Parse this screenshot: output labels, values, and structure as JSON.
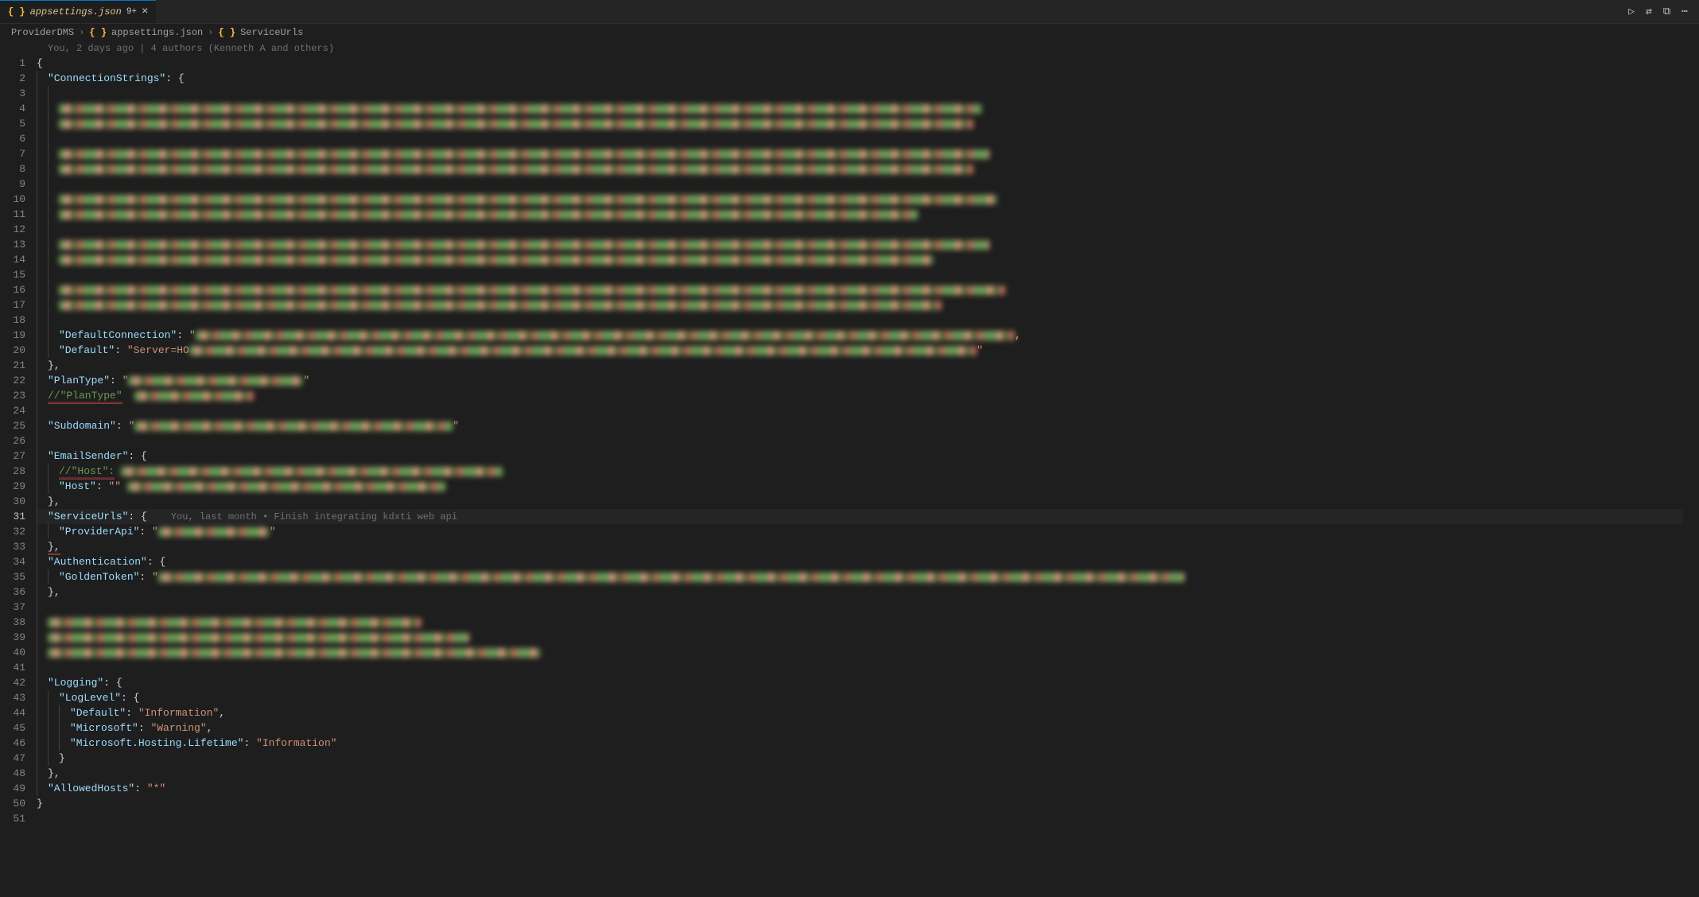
{
  "tab": {
    "file_icon": "{ }",
    "filename": "appsettings.json",
    "badge": "9+",
    "close_glyph": "×"
  },
  "toolbar": {
    "run_icon": "▷",
    "split_icon": "⧉",
    "diff_icon": "⇄",
    "more_icon": "⋯"
  },
  "breadcrumbs": {
    "items": [
      {
        "icon": "",
        "label": "ProviderDMS"
      },
      {
        "icon": "{ }",
        "label": "appsettings.json"
      },
      {
        "icon": "{ }",
        "label": "ServiceUrls"
      }
    ],
    "sep": "›"
  },
  "blame": "You, 2 days ago | 4 authors (Kenneth A and others)",
  "codelens_line31": "You, last month • Finish integrating kdxti web api",
  "lines_count": 51,
  "current_line": 31,
  "code": {
    "l1": {
      "open_brace": "{"
    },
    "l2": {
      "key": "ConnectionStrings",
      "open": "{"
    },
    "l19": {
      "key": "DefaultConnection",
      "value_prefix": "\""
    },
    "l20": {
      "key": "Default",
      "value_prefix": "\"Server=HO"
    },
    "l21": {
      "close": "},"
    },
    "l22": {
      "key": "PlanType",
      "value_prefix": "\""
    },
    "l23": {
      "comment_prefix": "//\"PlanType\""
    },
    "l25": {
      "key": "Subdomain",
      "value_prefix": "\""
    },
    "l27": {
      "key": "EmailSender",
      "open": "{"
    },
    "l28": {
      "comment_prefix": "//\"Host\":"
    },
    "l29": {
      "key": "Host",
      "value_prefix": "\"\""
    },
    "l30": {
      "close": "},"
    },
    "l31": {
      "key": "ServiceUrls",
      "open": "{"
    },
    "l32": {
      "key": "ProviderApi",
      "value_prefix": "\""
    },
    "l33": {
      "close": "},"
    },
    "l34": {
      "key": "Authentication",
      "open": "{"
    },
    "l35": {
      "key": "GoldenToken",
      "value_prefix": "\""
    },
    "l36": {
      "close": "},"
    },
    "l42": {
      "key": "Logging",
      "open": "{"
    },
    "l43": {
      "key": "LogLevel",
      "open": "{"
    },
    "l44": {
      "key": "Default",
      "value": "Information"
    },
    "l45": {
      "key": "Microsoft",
      "value": "Warning"
    },
    "l46": {
      "key": "Microsoft.Hosting.Lifetime",
      "value": "Information"
    },
    "l47": {
      "close": "}"
    },
    "l48": {
      "close": "},"
    },
    "l49": {
      "key": "AllowedHosts",
      "value": "*"
    },
    "l50": {
      "close_brace": "}"
    }
  }
}
